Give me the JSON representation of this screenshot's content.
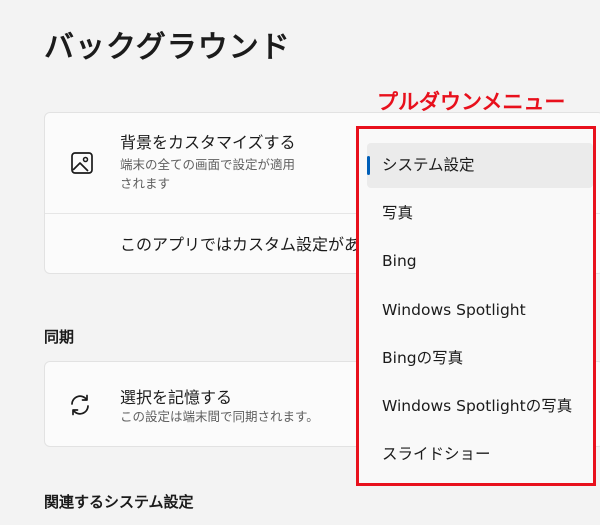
{
  "page_title": "バックグラウンド",
  "background_card": {
    "customize": {
      "icon": "image-icon",
      "title": "背景をカスタマイズする",
      "subtitle_line1": "端末の全ての画面で設定が適用",
      "subtitle_line2": "されます"
    },
    "per_app": {
      "title": "このアプリではカスタム設定がありま"
    }
  },
  "sync_section": {
    "label": "同期",
    "remember": {
      "icon": "sync-icon",
      "title": "選択を記憶する",
      "subtitle": "この設定は端末間で同期されます。"
    }
  },
  "related_section": {
    "label": "関連するシステム設定"
  },
  "annotation": {
    "label": "プルダウンメニュー",
    "color": "#e8101c"
  },
  "dropdown": {
    "selected_index": 0,
    "accent_color": "#005fb8",
    "options": [
      "システム設定",
      "写真",
      "Bing",
      "Windows Spotlight",
      "Bingの写真",
      "Windows Spotlightの写真",
      "スライドショー"
    ]
  }
}
